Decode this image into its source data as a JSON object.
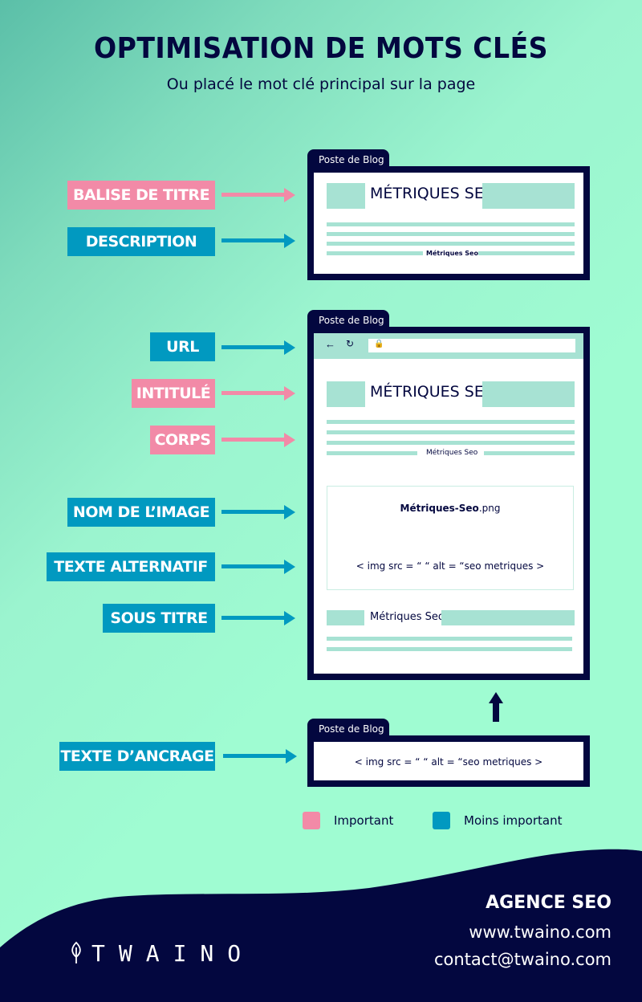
{
  "header": {
    "title": "OPTIMISATION DE MOTS CLÉS",
    "subtitle": "Ou placé le mot clé principal sur la page"
  },
  "colors": {
    "important": "#f28aa7",
    "less_important": "#0199c0",
    "navy": "#03073f",
    "mint": "#9ffcd2",
    "placeholder_bar": "#a7e2d3"
  },
  "labels": [
    {
      "text": "BALISE DE TITRE",
      "importance": "important"
    },
    {
      "text": "DESCRIPTION",
      "importance": "less_important"
    },
    {
      "text": "URL",
      "importance": "less_important"
    },
    {
      "text": "INTITULÉ",
      "importance": "important"
    },
    {
      "text": "CORPS",
      "importance": "important"
    },
    {
      "text": "NOM DE L’IMAGE",
      "importance": "less_important"
    },
    {
      "text": "TEXTE ALTERNATIF",
      "importance": "less_important"
    },
    {
      "text": "SOUS TITRE",
      "importance": "less_important"
    },
    {
      "text": "TEXTE D’ANCRAGE",
      "importance": "less_important"
    }
  ],
  "windows": {
    "serp": {
      "tab": "Poste de Blog",
      "heading": "MÉTRIQUES SEO",
      "small": "Métriques Seo"
    },
    "page": {
      "tab": "Poste de Blog",
      "heading": "MÉTRIQUES SEO",
      "small": "Métriques Seo",
      "image_name_bold": "Métriques-Seo",
      "image_name_ext": ".png",
      "img_code": "< img src = “ “  alt = “seo metriques  >",
      "subheading": "Métriques Seo"
    },
    "anchor": {
      "tab": "Poste de Blog",
      "img_code": "< img src = “ “  alt = “seo metriques  >"
    }
  },
  "legend": [
    {
      "label": "Important",
      "color": "#f28aa7"
    },
    {
      "label": "Moins important",
      "color": "#0199c0"
    }
  ],
  "footer": {
    "brand": "TWAINO",
    "agency": "AGENCE SEO",
    "website": "www.twaino.com",
    "email": "contact@twaino.com"
  }
}
